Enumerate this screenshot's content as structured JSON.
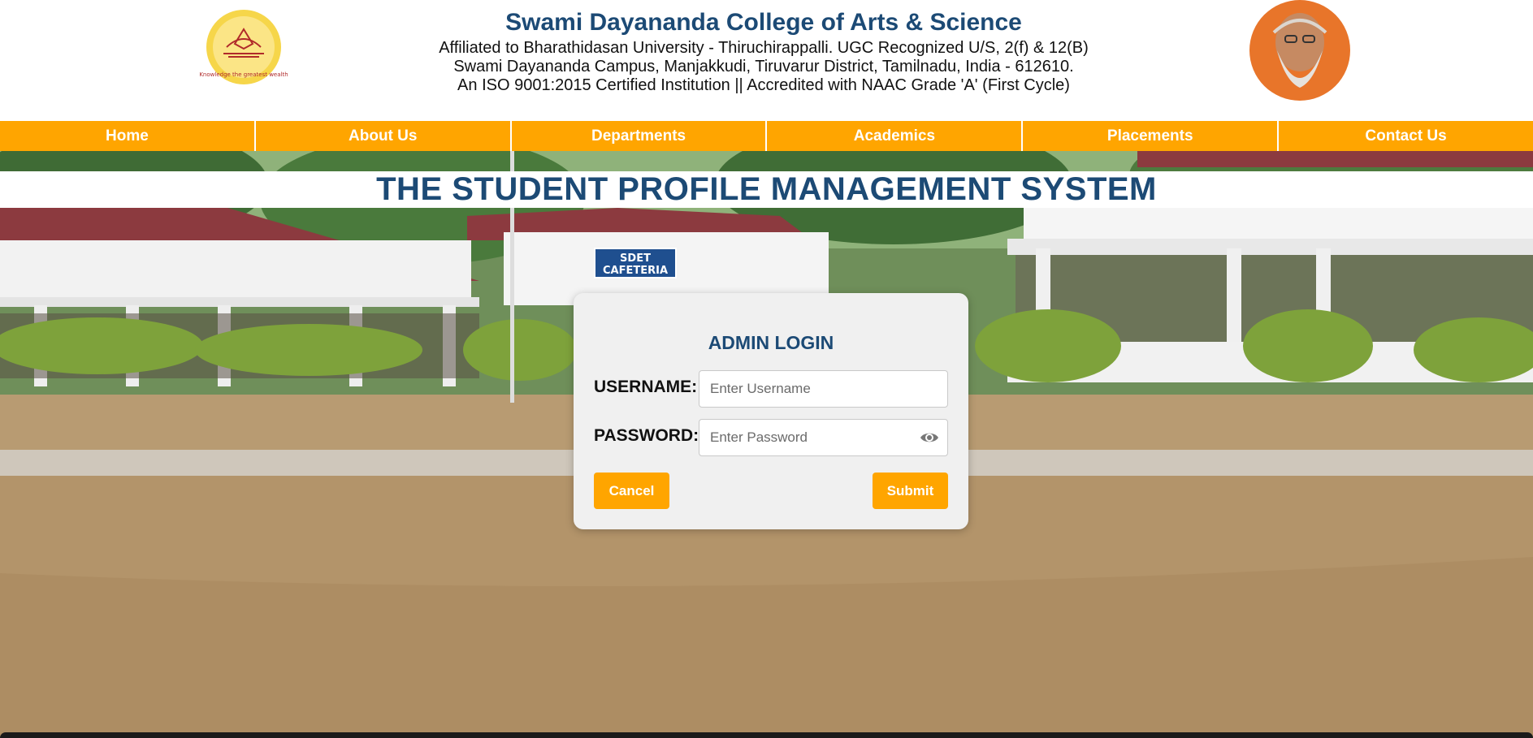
{
  "header": {
    "college_name": "Swami Dayananda College of Arts & Science",
    "lines": [
      "Affiliated to Bharathidasan University - Thiruchirappalli. UGC Recognized U/S, 2(f) & 12(B)",
      "Swami Dayananda Campus, Manjakkudi, Tiruvarur District, Tamilnadu, India - 612610.",
      "An ISO 9001:2015 Certified Institution || Accredited with NAAC Grade 'A' (First Cycle)"
    ],
    "logo_tagline": "Knowledge the greatest wealth"
  },
  "nav": {
    "items": [
      "Home",
      "About Us",
      "Departments",
      "Academics",
      "Placements",
      "Contact Us"
    ]
  },
  "page_title": "THE STUDENT PROFILE MANAGEMENT SYSTEM",
  "scene": {
    "sign_line1": "SDET",
    "sign_line2": "CAFETERIA"
  },
  "login": {
    "title": "ADMIN LOGIN",
    "username_label": "USERNAME:",
    "username_placeholder": "Enter Username",
    "password_label": "PASSWORD:",
    "password_placeholder": "Enter Password",
    "cancel_label": "Cancel",
    "submit_label": "Submit"
  },
  "colors": {
    "accent": "#ffa500",
    "title_blue": "#1c4a75"
  }
}
